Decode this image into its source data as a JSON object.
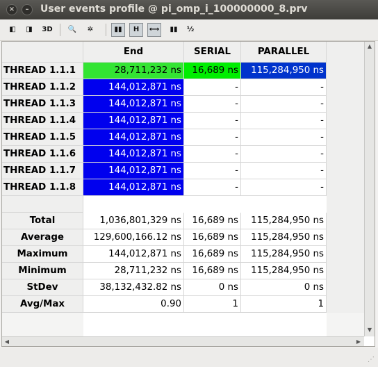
{
  "window": {
    "title": "User events profile @ pi_omp_i_100000000_8.prv",
    "close_glyph": "×",
    "minimize_glyph": "–"
  },
  "toolbar": [
    {
      "name": "view-events-icon",
      "glyph": "◧",
      "pressed": false
    },
    {
      "name": "view-code-icon",
      "glyph": "◨",
      "pressed": false
    },
    {
      "name": "3d-view-button",
      "glyph": "3D",
      "pressed": false
    },
    {
      "name": "zoom-icon",
      "glyph": "🔍",
      "pressed": false
    },
    {
      "name": "settings-icon",
      "glyph": "✲",
      "pressed": false
    },
    {
      "name": "gradient-color-icon",
      "glyph": "▮▮",
      "pressed": true
    },
    {
      "name": "hide-empty-button",
      "glyph": "H",
      "pressed": true
    },
    {
      "name": "horizontal-split-icon",
      "glyph": "⟷",
      "pressed": true
    },
    {
      "name": "semantic-color-icon",
      "glyph": "▮▮",
      "pressed": false
    },
    {
      "name": "fraction-icon",
      "glyph": "½",
      "pressed": false
    }
  ],
  "table": {
    "columns": [
      "End",
      "SERIAL",
      "PARALLEL"
    ],
    "rows": [
      {
        "label": "THREAD 1.1.1",
        "values": [
          "28,711,232 ns",
          "16,689 ns",
          "115,284,950 ns"
        ],
        "colors": [
          "#33e433",
          "#00ee00",
          "#0033cc"
        ]
      },
      {
        "label": "THREAD 1.1.2",
        "values": [
          "144,012,871 ns",
          "-",
          "-"
        ],
        "colors": [
          "#0000ee",
          "",
          ""
        ]
      },
      {
        "label": "THREAD 1.1.3",
        "values": [
          "144,012,871 ns",
          "-",
          "-"
        ],
        "colors": [
          "#0000ee",
          "",
          ""
        ]
      },
      {
        "label": "THREAD 1.1.4",
        "values": [
          "144,012,871 ns",
          "-",
          "-"
        ],
        "colors": [
          "#0000ee",
          "",
          ""
        ]
      },
      {
        "label": "THREAD 1.1.5",
        "values": [
          "144,012,871 ns",
          "-",
          "-"
        ],
        "colors": [
          "#0000ee",
          "",
          ""
        ]
      },
      {
        "label": "THREAD 1.1.6",
        "values": [
          "144,012,871 ns",
          "-",
          "-"
        ],
        "colors": [
          "#0000ee",
          "",
          ""
        ]
      },
      {
        "label": "THREAD 1.1.7",
        "values": [
          "144,012,871 ns",
          "-",
          "-"
        ],
        "colors": [
          "#0000ee",
          "",
          ""
        ]
      },
      {
        "label": "THREAD 1.1.8",
        "values": [
          "144,012,871 ns",
          "-",
          "-"
        ],
        "colors": [
          "#0000ee",
          "",
          ""
        ]
      }
    ],
    "stats": [
      {
        "label": "Total",
        "values": [
          "1,036,801,329 ns",
          "16,689 ns",
          "115,284,950 ns"
        ]
      },
      {
        "label": "Average",
        "values": [
          "129,600,166.12 ns",
          "16,689 ns",
          "115,284,950 ns"
        ]
      },
      {
        "label": "Maximum",
        "values": [
          "144,012,871 ns",
          "16,689 ns",
          "115,284,950 ns"
        ]
      },
      {
        "label": "Minimum",
        "values": [
          "28,711,232 ns",
          "16,689 ns",
          "115,284,950 ns"
        ]
      },
      {
        "label": "StDev",
        "values": [
          "38,132,432.82 ns",
          "0 ns",
          "0 ns"
        ]
      },
      {
        "label": "Avg/Max",
        "values": [
          "0.90",
          "1",
          "1"
        ]
      }
    ]
  },
  "scrollbars": {
    "up": "▲",
    "down": "▼",
    "left": "◀",
    "right": "▶"
  },
  "statusbar": {
    "grip": "⋰"
  }
}
